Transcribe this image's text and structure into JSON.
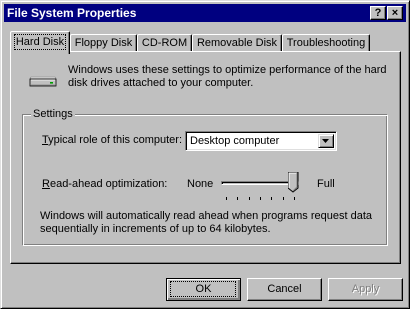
{
  "window": {
    "title": "File System Properties",
    "help_button": "?",
    "close_button": "×"
  },
  "tabs": [
    {
      "label": "Hard Disk",
      "active": true
    },
    {
      "label": "Floppy Disk",
      "active": false
    },
    {
      "label": "CD-ROM",
      "active": false
    },
    {
      "label": "Removable Disk",
      "active": false
    },
    {
      "label": "Troubleshooting",
      "active": false
    }
  ],
  "hard_disk": {
    "icon": "hard-disk-drive-icon",
    "intro": "Windows uses these settings to optimize performance of the hard disk drives attached to your computer.",
    "settings_group_label": "Settings",
    "role_label": "Typical role of this computer:",
    "role_value": "Desktop computer",
    "readahead_label": "Read-ahead optimization:",
    "readahead_min_label": "None",
    "readahead_max_label": "Full",
    "readahead_level_fraction": 1.0,
    "note": "Windows will automatically read ahead when programs request data sequentially in increments of up to 64 kilobytes."
  },
  "buttons": {
    "ok": "OK",
    "cancel": "Cancel",
    "apply": "Apply",
    "apply_disabled": true
  },
  "colors": {
    "titlebar": "#000080",
    "face": "#c0c0c0"
  }
}
